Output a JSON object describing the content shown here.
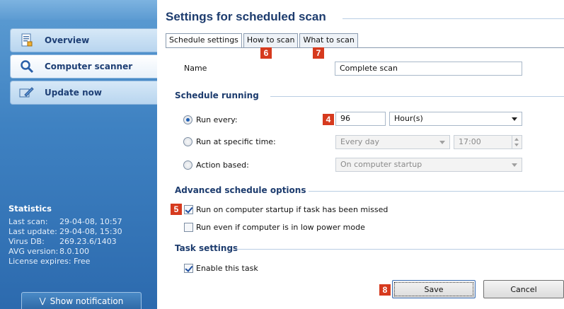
{
  "sidebar": {
    "nav": [
      {
        "label": "Overview",
        "icon": "document-icon"
      },
      {
        "label": "Computer scanner",
        "icon": "magnifier-icon"
      },
      {
        "label": "Update now",
        "icon": "update-icon"
      }
    ],
    "stats_title": "Statistics",
    "stats": [
      {
        "key": "Last scan:",
        "value": "29-04-08, 10:57"
      },
      {
        "key": "Last update:",
        "value": "29-04-08, 15:30"
      },
      {
        "key": "Virus DB:",
        "value": "269.23.6/1403"
      },
      {
        "key": "AVG version:",
        "value": "8.0.100"
      }
    ],
    "license": "License expires: Free",
    "show_notification": "Show notification"
  },
  "main": {
    "title": "Settings for scheduled scan",
    "tabs": [
      {
        "label": "Schedule settings"
      },
      {
        "label": "How to scan"
      },
      {
        "label": "What to scan"
      }
    ],
    "badges": {
      "how": "6",
      "what": "7",
      "run_every": "4",
      "startup": "5",
      "save": "8"
    },
    "name_label": "Name",
    "name_value": "Complete scan",
    "schedule_running": "Schedule running",
    "run_every_label": "Run every:",
    "run_every_value": "96",
    "run_every_unit": "Hour(s)",
    "specific_time_label": "Run at specific time:",
    "specific_time_freq": "Every day",
    "specific_time_value": "17:00",
    "action_based_label": "Action based:",
    "action_based_value": "On computer startup",
    "advanced_title": "Advanced schedule options",
    "startup_missed": "Run on computer startup if task has been missed",
    "low_power": "Run even if computer is in low power mode",
    "task_settings": "Task settings",
    "enable_task": "Enable this task",
    "save": "Save",
    "cancel": "Cancel"
  },
  "colors": {
    "accent": "#1d3c6e",
    "badge": "#d63a1e",
    "sidebar": "#3f82c2"
  }
}
